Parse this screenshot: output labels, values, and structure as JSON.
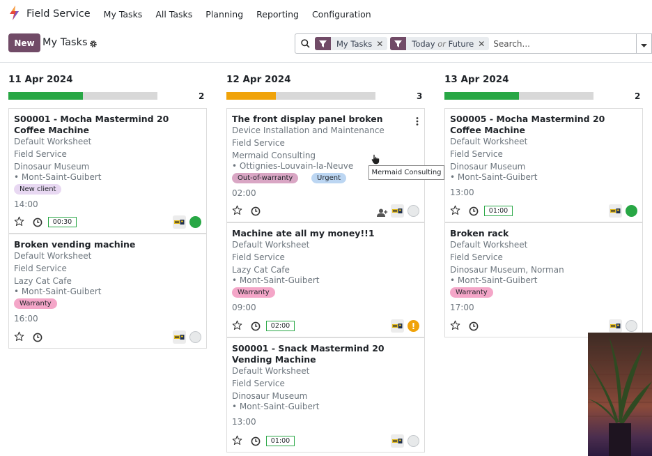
{
  "app": {
    "title": "Field Service",
    "menu": [
      "My Tasks",
      "All Tasks",
      "Planning",
      "Reporting",
      "Configuration"
    ]
  },
  "control": {
    "new_label": "New",
    "page_title": "My Tasks",
    "facets": [
      {
        "label": "My Tasks"
      },
      {
        "label_pre": "Today",
        "label_or": "or",
        "label_post": "Future"
      }
    ],
    "search_placeholder": "Search..."
  },
  "colors": {
    "brand": "#714b67",
    "green": "#28a745",
    "orange": "#f0a30a"
  },
  "columns": [
    {
      "date": "11 Apr 2024",
      "count": "2",
      "progress_color": "#28a745",
      "progress": 0.5,
      "cards": [
        {
          "title": "S00001 - Mocha Mastermind 20 Coffee Machine",
          "worksheet": "Default Worksheet",
          "project": "Field Service",
          "customer": "Dinosaur Museum",
          "city": "• Mont-Saint-Guibert",
          "tags": [
            "New client"
          ],
          "time": "14:00",
          "timer": "00:30",
          "status": "green"
        },
        {
          "title": "Broken vending machine",
          "worksheet": "Default Worksheet",
          "project": "Field Service",
          "customer": "Lazy Cat Cafe",
          "city": "• Mont-Saint-Guibert",
          "tags": [
            "Warranty"
          ],
          "time": "16:00",
          "status": "grey"
        }
      ]
    },
    {
      "date": "12 Apr 2024",
      "count": "3",
      "progress_color": "#f0a30a",
      "progress": 0.33,
      "cards": [
        {
          "title": "The front display panel broken",
          "worksheet": "Device Installation and Maintenance",
          "project": "Field Service",
          "customer": "Mermaid Consulting",
          "city": "• Ottignies-Louvain-la-Neuve",
          "tags": [
            "Out-of-warranty",
            "Urgent"
          ],
          "time": "02:00",
          "status": "grey"
        },
        {
          "title": "Machine ate all my money!!1",
          "worksheet": "Default Worksheet",
          "project": "Field Service",
          "customer": "Lazy Cat Cafe",
          "city": "• Mont-Saint-Guibert",
          "tags": [
            "Warranty"
          ],
          "time": "09:00",
          "timer": "02:00",
          "status": "orange",
          "status_symbol": "!"
        },
        {
          "title": "S00001 - Snack Mastermind 20 Vending Machine",
          "worksheet": "Default Worksheet",
          "project": "Field Service",
          "customer": "Dinosaur Museum",
          "city": "• Mont-Saint-Guibert",
          "time": "13:00",
          "timer": "01:00",
          "status": "grey"
        }
      ]
    },
    {
      "date": "13 Apr 2024",
      "count": "2",
      "progress_color": "#28a745",
      "progress": 0.5,
      "cards": [
        {
          "title": "S00005 - Mocha Mastermind 20 Coffee Machine",
          "worksheet": "Default Worksheet",
          "project": "Field Service",
          "customer": "Dinosaur Museum",
          "city": "• Mont-Saint-Guibert",
          "time": "13:00",
          "timer": "01:00",
          "status": "green"
        },
        {
          "title": "Broken rack",
          "worksheet": "Default Worksheet",
          "project": "Field Service",
          "customer": "Dinosaur Museum, Norman",
          "city": "• Mont-Saint-Guibert",
          "tags": [
            "Warranty"
          ],
          "time": "17:00",
          "status": "grey"
        }
      ]
    }
  ],
  "tooltip": "Mermaid Consulting"
}
